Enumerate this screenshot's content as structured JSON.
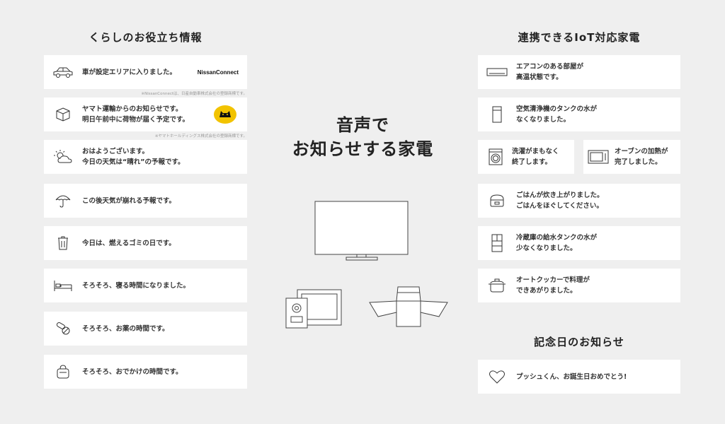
{
  "left": {
    "title": "くらしのお役立ち情報",
    "items": [
      {
        "icon": "car-icon",
        "text": "車が設定エリアに入りました。"
      },
      {
        "icon": "package-icon",
        "text": "ヤマト運輸からのお知らせです。\n明日午前中に荷物が届く予定です。"
      },
      {
        "icon": "weather-icon",
        "text": "おはようございます。\n今日の天気は“晴れ”の予報です。"
      },
      {
        "icon": "umbrella-icon",
        "text": "この後天気が崩れる予報です。"
      },
      {
        "icon": "trash-icon",
        "text": "今日は、燃えるゴミの日です。"
      },
      {
        "icon": "bed-icon",
        "text": "そろそろ、寝る時間になりました。"
      },
      {
        "icon": "pill-icon",
        "text": "そろそろ、お薬の時間です。"
      },
      {
        "icon": "bag-icon",
        "text": "そろそろ、おでかけの時間です。"
      }
    ],
    "nissan_logo": "NissanConnect",
    "nissan_note": "※NissanConnectは、日産自動車株式会社の登録商標です。",
    "yamato_note": "※ヤマトホールディングス株式会社の登録商標です。"
  },
  "center": {
    "title_line1": "音声で",
    "title_line2": "お知らせする家電"
  },
  "right": {
    "title": "連携できるIoT対応家電",
    "items": [
      {
        "icon": "aircon-icon",
        "text": "エアコンのある部屋が\n高温状態です。"
      },
      {
        "icon": "air-purifier-icon",
        "text": "空気清浄機のタンクの水が\nなくなりました。"
      },
      {
        "icon": "washer-icon",
        "text": "洗濯がまもなく\n終了します。"
      },
      {
        "icon": "oven-icon",
        "text": "オーブンの加熱が\n完了しました。"
      },
      {
        "icon": "rice-cooker-icon",
        "text": "ごはんが炊き上がりました。\nごはんをほぐしてください。"
      },
      {
        "icon": "fridge-icon",
        "text": "冷蔵庫の給水タンクの水が\n少なくなりました。"
      },
      {
        "icon": "pot-icon",
        "text": "オートクッカーで料理が\nできあがりました。"
      }
    ],
    "anniversary_title": "記念日のお知らせ",
    "anniversary": {
      "icon": "heart-icon",
      "text": "プッシュくん、お誕生日おめでとう!"
    }
  }
}
